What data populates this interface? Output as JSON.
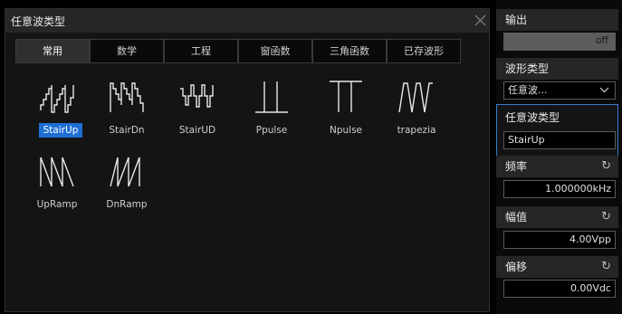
{
  "dialog": {
    "title": "任意波类型",
    "close_icon": "close-x-icon"
  },
  "tabs": [
    {
      "label": "常用",
      "active": true
    },
    {
      "label": "数学",
      "active": false
    },
    {
      "label": "工程",
      "active": false
    },
    {
      "label": "窗函数",
      "active": false
    },
    {
      "label": "三角函数",
      "active": false
    },
    {
      "label": "已存波形",
      "active": false
    }
  ],
  "waveforms": [
    {
      "label": "StairUp",
      "icon": "stair-up-wave-icon",
      "selected": true
    },
    {
      "label": "StairDn",
      "icon": "stair-down-wave-icon",
      "selected": false
    },
    {
      "label": "StairUD",
      "icon": "stair-updown-wave-icon",
      "selected": false
    },
    {
      "label": "Ppulse",
      "icon": "positive-pulse-icon",
      "selected": false
    },
    {
      "label": "Npulse",
      "icon": "negative-pulse-icon",
      "selected": false
    },
    {
      "label": "trapezia",
      "icon": "trapezoid-wave-icon",
      "selected": false
    },
    {
      "label": "UpRamp",
      "icon": "up-ramp-wave-icon",
      "selected": false
    },
    {
      "label": "DnRamp",
      "icon": "down-ramp-wave-icon",
      "selected": false
    }
  ],
  "panel": {
    "output": {
      "label": "输出",
      "value": "off"
    },
    "wave_type": {
      "label": "波形类型",
      "value": "任意波..."
    },
    "arb_type": {
      "label": "任意波类型",
      "value": "StairUp"
    },
    "frequency": {
      "label": "频率",
      "value": "1.000000kHz"
    },
    "amplitude": {
      "label": "幅值",
      "value": "4.00Vpp"
    },
    "offset": {
      "label": "偏移",
      "value": "0.00Vdc"
    }
  },
  "colors": {
    "selection": "#1e6fd4",
    "accent_border": "#3b7bd0"
  }
}
